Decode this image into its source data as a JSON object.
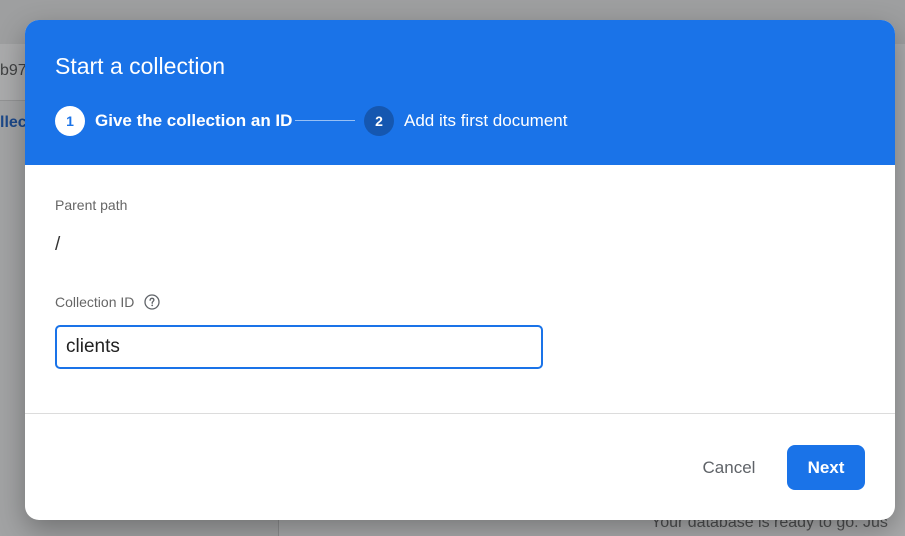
{
  "background": {
    "project_fragment": "b97",
    "side_link_fragment": "llec",
    "footer_fragment": "Your database is ready to go. Jus"
  },
  "dialog": {
    "title": "Start a collection",
    "steps": [
      {
        "number": "1",
        "label": "Give the collection an ID",
        "active": true
      },
      {
        "number": "2",
        "label": "Add its first document",
        "active": false
      }
    ],
    "parent_path": {
      "label": "Parent path",
      "value": "/"
    },
    "collection_id": {
      "label": "Collection ID",
      "value": "clients",
      "help_icon": "help-circle-icon"
    },
    "buttons": {
      "cancel": "Cancel",
      "next": "Next"
    }
  },
  "colors": {
    "accent": "#1a73e8",
    "step_inactive": "#1557b0",
    "scrim": "rgba(32,33,36,0.38)"
  }
}
